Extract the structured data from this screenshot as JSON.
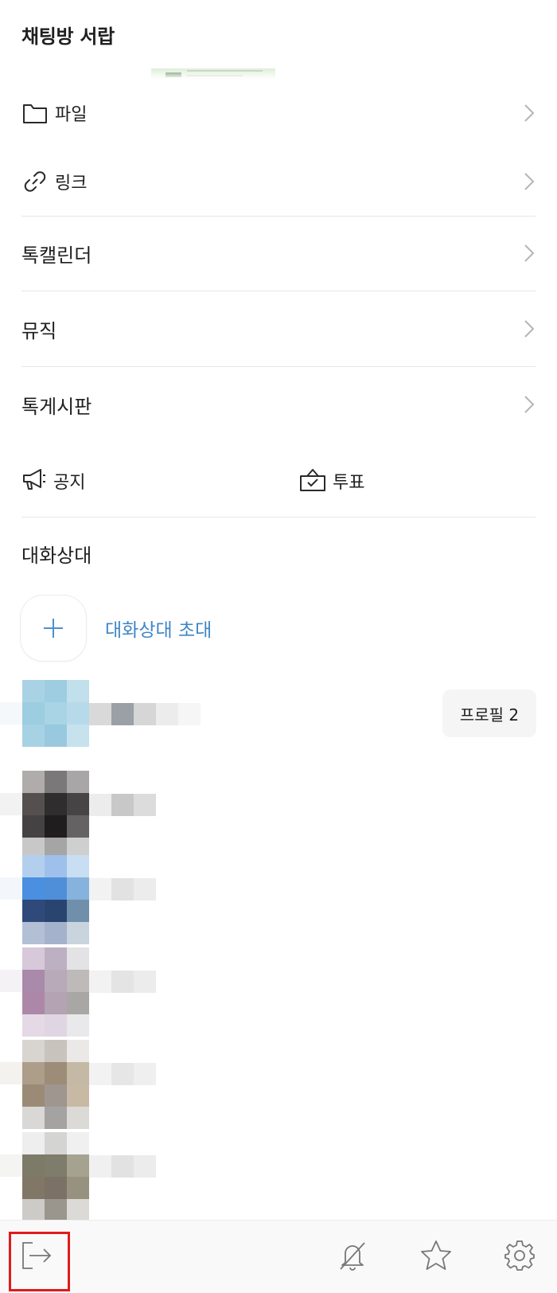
{
  "drawer": {
    "title": "채팅방 서랍"
  },
  "menu": {
    "files": {
      "label": "파일",
      "icon": "folder-icon"
    },
    "links": {
      "label": "링크",
      "icon": "link-icon"
    },
    "calendar": {
      "label": "톡캘린더"
    },
    "music": {
      "label": "뮤직"
    },
    "board": {
      "label": "톡게시판"
    },
    "notice": {
      "label": "공지",
      "icon": "megaphone-icon"
    },
    "poll": {
      "label": "투표",
      "icon": "ballot-box-icon"
    }
  },
  "members": {
    "title": "대화상대",
    "invite_label": "대화상대 초대",
    "profile_button": "프로필 2"
  },
  "bottom_bar": {
    "icons": [
      "leave-icon",
      "bell-off-icon",
      "star-icon",
      "settings-gear-icon"
    ],
    "highlight_color": "#e01b1b"
  },
  "colors": {
    "accent": "#3e86c8"
  }
}
